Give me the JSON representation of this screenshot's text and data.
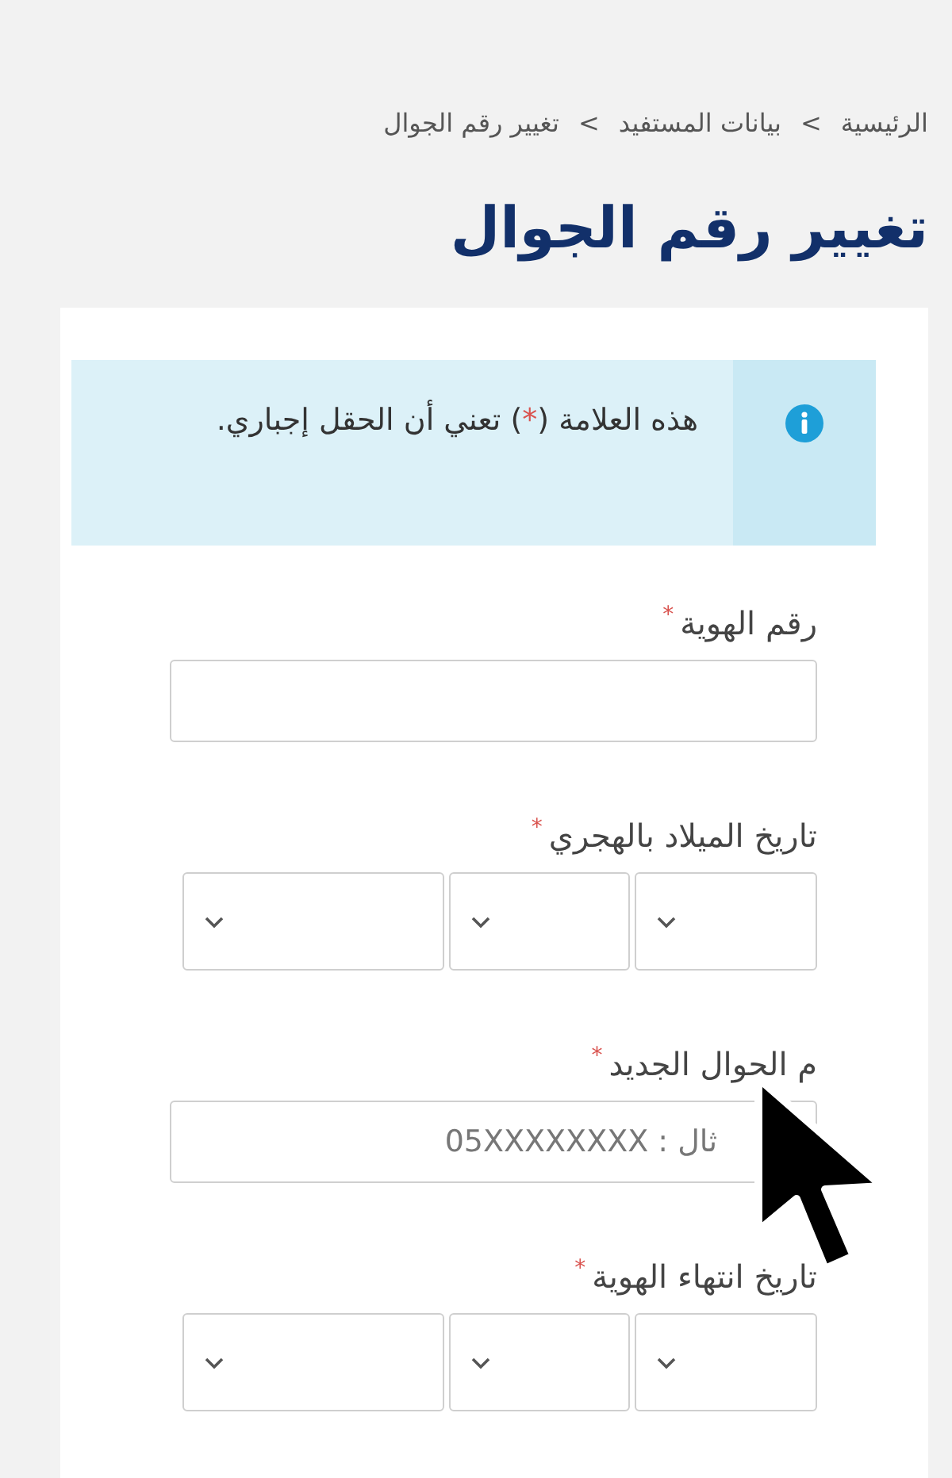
{
  "breadcrumb": [
    {
      "label": "الرئيسية"
    },
    {
      "label": "بيانات المستفيد"
    },
    {
      "label": "تغيير رقم الجوال"
    }
  ],
  "breadcrumb_separator": ">",
  "title": "تغيير رقم الجوال",
  "notice": {
    "text_start": "هذه العلامة (",
    "mark": "*",
    "text_end": ") تعني أن الحقل إجباري."
  },
  "fields": [
    {
      "kind": "text",
      "label": "رقم الهوية",
      "required_mark": "*"
    },
    {
      "kind": "date",
      "label": "تاريخ الميلاد بالهجري",
      "required_mark": "*"
    },
    {
      "kind": "text",
      "label": "م الجوال الجديد",
      "required_mark": "*",
      "placeholder": "ثال : 05XXXXXXXX"
    },
    {
      "kind": "date",
      "label": "تاريخ انتهاء الهوية",
      "required_mark": "*"
    }
  ]
}
